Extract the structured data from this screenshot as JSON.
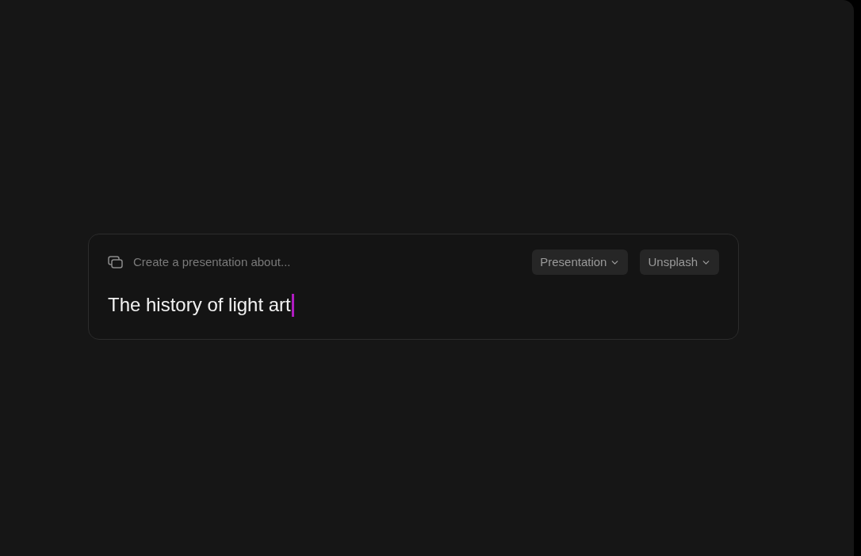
{
  "prompt_card": {
    "label": "Create a presentation about...",
    "dropdowns": [
      {
        "label": "Presentation"
      },
      {
        "label": "Unsplash"
      }
    ],
    "input": {
      "value": "The history of light art"
    }
  }
}
